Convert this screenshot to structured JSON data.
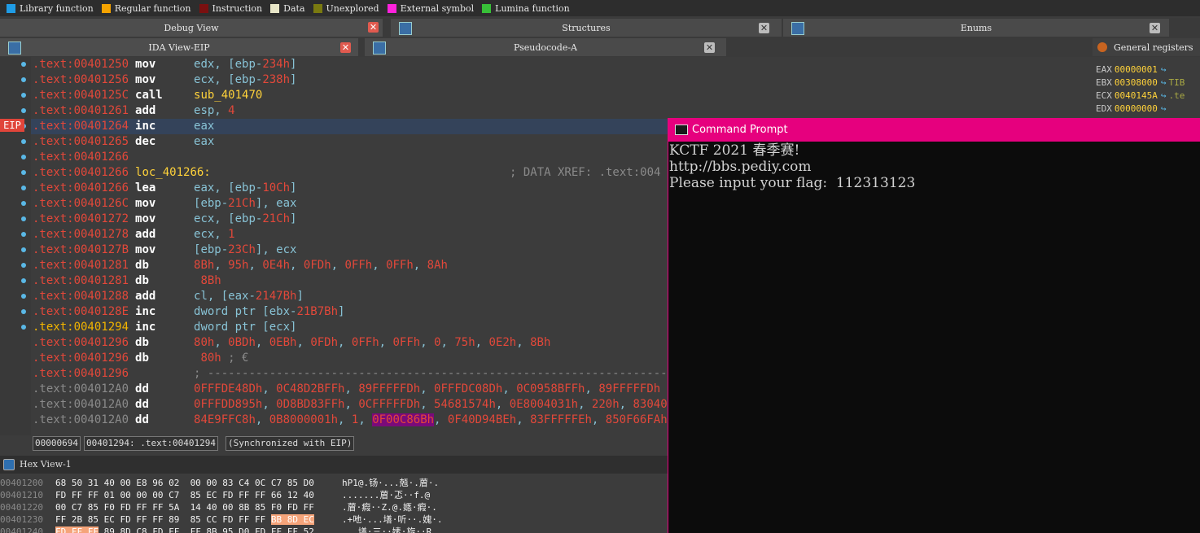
{
  "legend": [
    {
      "label": "Library function",
      "color": "#1f9ce6"
    },
    {
      "label": "Regular function",
      "color": "#f5a300"
    },
    {
      "label": "Instruction",
      "color": "#7a1010"
    },
    {
      "label": "Data",
      "color": "#e8e6c8"
    },
    {
      "label": "Unexplored",
      "color": "#7a7a10"
    },
    {
      "label": "External symbol",
      "color": "#ff22dd"
    },
    {
      "label": "Lumina function",
      "color": "#38c038"
    }
  ],
  "tabs": {
    "debug_view": "Debug View",
    "structures": "Structures",
    "enums": "Enums",
    "ida_view": "IDA View-EIP",
    "pseudocode": "Pseudocode-A",
    "general_registers": "General registers",
    "hex_view": "Hex View-1"
  },
  "eip_label": "EIP",
  "listing": [
    {
      "addr": ".text:00401250",
      "mn": "mov",
      "ops": [
        [
          "op",
          "edx, [ebp-"
        ],
        [
          "num",
          "234h"
        ],
        [
          "op",
          "]"
        ]
      ]
    },
    {
      "addr": ".text:00401256",
      "mn": "mov",
      "ops": [
        [
          "op",
          "ecx, [ebp-"
        ],
        [
          "num",
          "238h"
        ],
        [
          "op",
          "]"
        ]
      ]
    },
    {
      "addr": ".text:0040125C",
      "mn": "call",
      "ops": [
        [
          "fn",
          "sub_401470"
        ]
      ]
    },
    {
      "addr": ".text:00401261",
      "mn": "add",
      "ops": [
        [
          "op",
          "esp, "
        ],
        [
          "num",
          "4"
        ]
      ]
    },
    {
      "addr": ".text:00401264",
      "mn": "inc",
      "ops": [
        [
          "op",
          "eax"
        ]
      ]
    },
    {
      "addr": ".text:00401265",
      "mn": "dec",
      "ops": [
        [
          "op",
          "eax"
        ]
      ]
    },
    {
      "addr": ".text:00401266",
      "mn": "",
      "ops": []
    },
    {
      "addr": ".text:00401266",
      "mn": "loc_401266:",
      "label": true,
      "ops": [],
      "comment": "; DATA XREF: .text:004"
    },
    {
      "addr": ".text:00401266",
      "mn": "lea",
      "ops": [
        [
          "op",
          "eax, [ebp-"
        ],
        [
          "num",
          "10Ch"
        ],
        [
          "op",
          "]"
        ]
      ]
    },
    {
      "addr": ".text:0040126C",
      "mn": "mov",
      "ops": [
        [
          "op",
          "[ebp-"
        ],
        [
          "num",
          "21Ch"
        ],
        [
          "op",
          "], eax"
        ]
      ]
    },
    {
      "addr": ".text:00401272",
      "mn": "mov",
      "ops": [
        [
          "op",
          "ecx, [ebp-"
        ],
        [
          "num",
          "21Ch"
        ],
        [
          "op",
          "]"
        ]
      ]
    },
    {
      "addr": ".text:00401278",
      "mn": "add",
      "ops": [
        [
          "op",
          "ecx, "
        ],
        [
          "num",
          "1"
        ]
      ]
    },
    {
      "addr": ".text:0040127B",
      "mn": "mov",
      "ops": [
        [
          "op",
          "[ebp-"
        ],
        [
          "num",
          "23Ch"
        ],
        [
          "op",
          "], ecx"
        ]
      ]
    },
    {
      "addr": ".text:00401281",
      "mn": "db",
      "ops": [
        [
          "num",
          "8Bh"
        ],
        [
          "op",
          ", "
        ],
        [
          "num",
          "95h"
        ],
        [
          "op",
          ", "
        ],
        [
          "num",
          "0E4h"
        ],
        [
          "op",
          ", "
        ],
        [
          "num",
          "0FDh"
        ],
        [
          "op",
          ", "
        ],
        [
          "num",
          "0FFh"
        ],
        [
          "op",
          ", "
        ],
        [
          "num",
          "0FFh"
        ],
        [
          "op",
          ", "
        ],
        [
          "num",
          "8Ah"
        ]
      ]
    },
    {
      "addr": ".text:00401281",
      "mn": "db",
      "ops": [
        [
          "num",
          " 8Bh"
        ]
      ]
    },
    {
      "addr": ".text:00401288",
      "mn": "add",
      "ops": [
        [
          "op",
          "cl, [eax-"
        ],
        [
          "num",
          "2147Bh"
        ],
        [
          "op",
          "]"
        ]
      ]
    },
    {
      "addr": ".text:0040128E",
      "mn": "inc",
      "ops": [
        [
          "op",
          "dword ptr [ebx-"
        ],
        [
          "num",
          "21B7Bh"
        ],
        [
          "op",
          "]"
        ]
      ]
    },
    {
      "addr": ".text:00401294",
      "alt": true,
      "mn": "inc",
      "ops": [
        [
          "op",
          "dword ptr [ecx]"
        ]
      ]
    },
    {
      "addr": ".text:00401296",
      "mn": "db",
      "ops": [
        [
          "num",
          "80h"
        ],
        [
          "op",
          ", "
        ],
        [
          "num",
          "0BDh"
        ],
        [
          "op",
          ", "
        ],
        [
          "num",
          "0EBh"
        ],
        [
          "op",
          ", "
        ],
        [
          "num",
          "0FDh"
        ],
        [
          "op",
          ", "
        ],
        [
          "num",
          "0FFh"
        ],
        [
          "op",
          ", "
        ],
        [
          "num",
          "0FFh"
        ],
        [
          "op",
          ", "
        ],
        [
          "num",
          "0"
        ],
        [
          "op",
          ", "
        ],
        [
          "num",
          "75h"
        ],
        [
          "op",
          ", "
        ],
        [
          "num",
          "0E2h"
        ],
        [
          "op",
          ", "
        ],
        [
          "num",
          "8Bh"
        ]
      ]
    },
    {
      "addr": ".text:00401296",
      "mn": "db",
      "ops": [
        [
          "num",
          " 80h"
        ],
        [
          "cmt",
          " ; €"
        ]
      ]
    },
    {
      "addr": ".text:00401296",
      "mn": "",
      "ops": [
        [
          "cmt",
          "; -----------------------------------------------------------------------------------------"
        ]
      ]
    },
    {
      "addr": ".text:004012A0",
      "dim": true,
      "mn": "dd",
      "ops": [
        [
          "num",
          "0FFFDE48Dh"
        ],
        [
          "op",
          ", "
        ],
        [
          "num",
          "0C48D2BFFh"
        ],
        [
          "op",
          ", "
        ],
        [
          "num",
          "89FFFFFDh"
        ],
        [
          "op",
          ", "
        ],
        [
          "num",
          "0FFFDC08Dh"
        ],
        [
          "op",
          ", "
        ],
        [
          "num",
          "0C0958BFFh"
        ],
        [
          "op",
          ", "
        ],
        [
          "num",
          "89FFFFFDh"
        ]
      ]
    },
    {
      "addr": ".text:004012A0",
      "dim": true,
      "mn": "dd",
      "ops": [
        [
          "num",
          "0FFFDD895h"
        ],
        [
          "op",
          ", "
        ],
        [
          "num",
          "0D8BD83FFh"
        ],
        [
          "op",
          ", "
        ],
        [
          "num",
          "0CFFFFFDh"
        ],
        [
          "op",
          ", "
        ],
        [
          "num",
          "54681574h"
        ],
        [
          "op",
          ", "
        ],
        [
          "num",
          "0E8004031h"
        ],
        [
          "op",
          ", "
        ],
        [
          "num",
          "220h"
        ],
        [
          "op",
          ", "
        ],
        [
          "num",
          "83040"
        ]
      ]
    },
    {
      "addr": ".text:004012A0",
      "dim": true,
      "mn": "dd",
      "ops": [
        [
          "num",
          "84E9FFC8h"
        ],
        [
          "op",
          ", "
        ],
        [
          "num",
          "0B8000001h"
        ],
        [
          "op",
          ", "
        ],
        [
          "num",
          "1"
        ],
        [
          "op",
          ", "
        ],
        [
          "hl",
          "0F00C86Bh"
        ],
        [
          "op",
          ", "
        ],
        [
          "num",
          "0F40D94BEh"
        ],
        [
          "op",
          ", "
        ],
        [
          "num",
          "83FFFFFEh"
        ],
        [
          "op",
          ", "
        ],
        [
          "num",
          "850F66FAh"
        ]
      ]
    }
  ],
  "status": {
    "offset": "00000694",
    "location": "00401294: .text:00401294",
    "sync": "(Synchronized with EIP)"
  },
  "hex_rows": [
    {
      "addr": "00401200",
      "bytes": "68 50 31 40 00 E8 96 02  00 00 83 C4 0C C7 85 D0",
      "ascii": "hP1@.钖·...兡·.葿·."
    },
    {
      "addr": "00401210",
      "bytes": "FD FF FF 01 00 00 00 C7  85 EC FD FF FF 66 12 40",
      "ascii": ".......葿·忑··f.@"
    },
    {
      "addr": "00401220",
      "bytes": "00 C7 85 F0 FD FF FF 5A  14 40 00 8B 85 F0 FD FF",
      "ascii": ".葿·瘕··Z.@.嫕·瘕·."
    },
    {
      "addr": "00401230",
      "bytes": "FF 2B 85 EC FD FF FF 89  85 CC FD FF FF ",
      "sel": "BB 8D EC",
      "ascii": ".+吔·...墡·听··.媿·."
    },
    {
      "addr": "00401240",
      "bytes": "",
      "sel": "FD FF FF",
      "rest": " 89 8D C8 FD FF  FF 8B 95 D0 FD FF FF 52",
      "ascii": "...墡·三··嫊·旋··R"
    }
  ],
  "registers": [
    {
      "name": "EAX",
      "value": "00000001",
      "tag": ""
    },
    {
      "name": "EBX",
      "value": "00308000",
      "tag": "TIB"
    },
    {
      "name": "ECX",
      "value": "0040145A",
      "tag": ".te"
    },
    {
      "name": "EDX",
      "value": "00000000",
      "tag": ""
    }
  ],
  "cmd": {
    "title": "Command Prompt",
    "lines": [
      "KCTF 2021 春季赛!",
      "http://bbs.pediy.com",
      "Please input your flag:  112313123"
    ]
  },
  "colors": {
    "accent": "#e6007e",
    "eip": "#e0453a"
  }
}
